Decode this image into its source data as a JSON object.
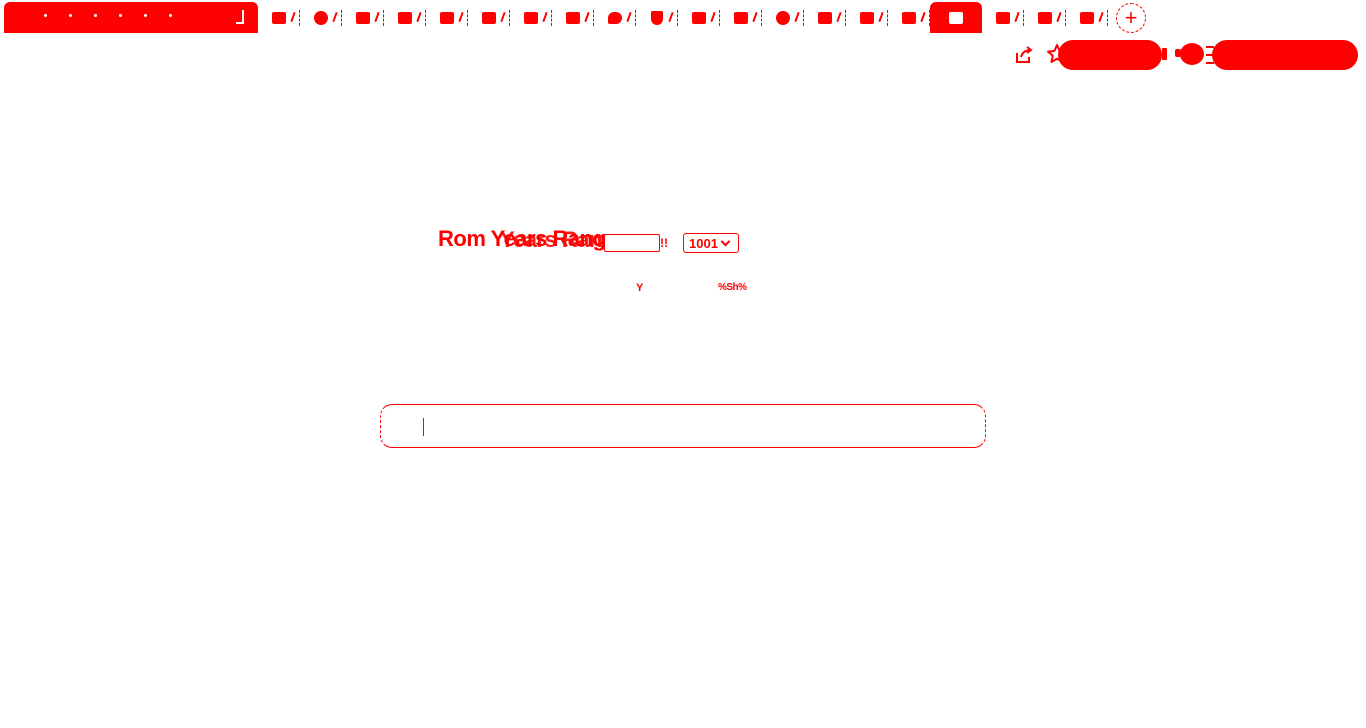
{
  "browser": {
    "tabs": [
      {
        "icon": "grid-favicon-icon"
      },
      {
        "icon": "circle-favicon-icon"
      },
      {
        "icon": "grid-favicon-icon"
      },
      {
        "icon": "grid-favicon-icon"
      },
      {
        "icon": "grid-favicon-icon"
      },
      {
        "icon": "grid-favicon-icon"
      },
      {
        "icon": "grid-favicon-icon"
      },
      {
        "icon": "grid-favicon-icon"
      },
      {
        "icon": "chat-favicon-icon"
      },
      {
        "icon": "shield-favicon-icon"
      },
      {
        "icon": "grid-favicon-icon"
      },
      {
        "icon": "grid-favicon-icon"
      },
      {
        "icon": "circle-favicon-icon"
      },
      {
        "icon": "grid-favicon-icon"
      },
      {
        "icon": "hand-favicon-icon"
      },
      {
        "icon": "square-favicon-icon"
      },
      {
        "icon": "square-favicon-icon",
        "active": true
      },
      {
        "icon": "grid-favicon-icon"
      },
      {
        "icon": "square-favicon-icon"
      },
      {
        "icon": "monitor-favicon-icon"
      }
    ],
    "new_tab_label": "+",
    "toolbar_icons": [
      "share-icon",
      "star-icon",
      "extension-icon",
      "puzzle-icon",
      "menu-icon"
    ]
  },
  "page": {
    "heading_primary": "Rom Years Ranger",
    "heading_overlay": "Years Ranger",
    "small_box_text": "",
    "bang_text": "!!",
    "year_select": {
      "value": "1001",
      "options": [
        "1001"
      ]
    },
    "sub_text_a": "Y",
    "sub_text_b": "%Sh%",
    "input": {
      "value": "",
      "placeholder": ""
    }
  },
  "colors": {
    "accent": "#ff0000",
    "background": "#ffffff"
  }
}
